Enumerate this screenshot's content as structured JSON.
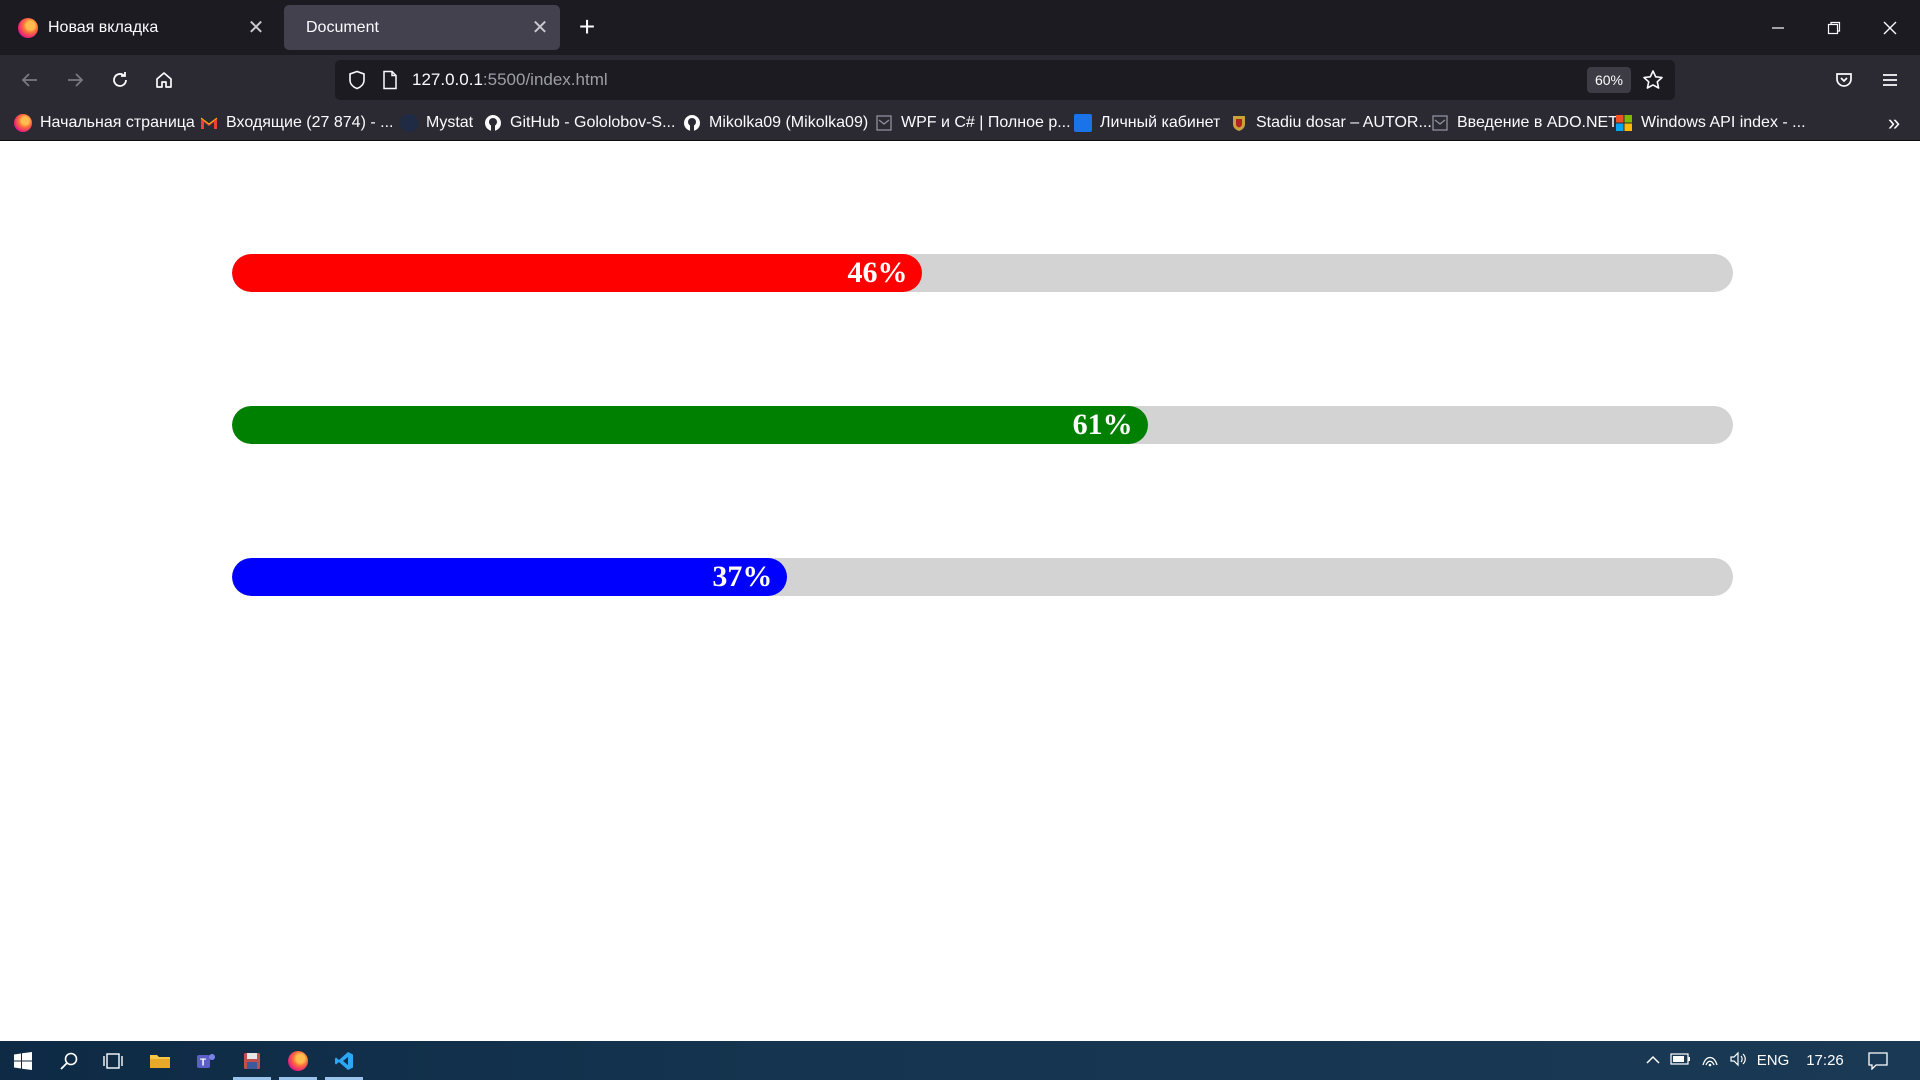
{
  "browser": {
    "tabs": [
      {
        "title": "Новая вкладка",
        "active": false
      },
      {
        "title": "Document",
        "active": true
      }
    ],
    "url": {
      "host": "127.0.0.1",
      "rest": ":5500/index.html"
    },
    "zoom": "60%",
    "bookmarks": [
      {
        "label": "Начальная страница",
        "icon": "firefox-icon"
      },
      {
        "label": "Входящие (27 874) - ...",
        "icon": "gmail-icon"
      },
      {
        "label": "Mystat",
        "icon": "mystat-icon"
      },
      {
        "label": "GitHub - Gololobov-S...",
        "icon": "github-icon"
      },
      {
        "label": "Mikolka09 (Mikolka09)",
        "icon": "github-icon"
      },
      {
        "label": "WPF и C# | Полное р...",
        "icon": "page-icon"
      },
      {
        "label": "Личный кабинет",
        "icon": "cabinet-icon"
      },
      {
        "label": "Stadiu dosar – AUTOR...",
        "icon": "crest-icon"
      },
      {
        "label": "Введение в ADO.NET",
        "icon": "page-icon"
      },
      {
        "label": "Windows API index - ...",
        "icon": "microsoft-icon"
      }
    ]
  },
  "progress_bars": [
    {
      "label": "46%",
      "value": 46,
      "color": "#ff0000"
    },
    {
      "label": "61%",
      "value": 61,
      "color": "#008000"
    },
    {
      "label": "37%",
      "value": 37,
      "color": "#0000ff"
    }
  ],
  "taskbar": {
    "language": "ENG",
    "time": "17:26"
  }
}
